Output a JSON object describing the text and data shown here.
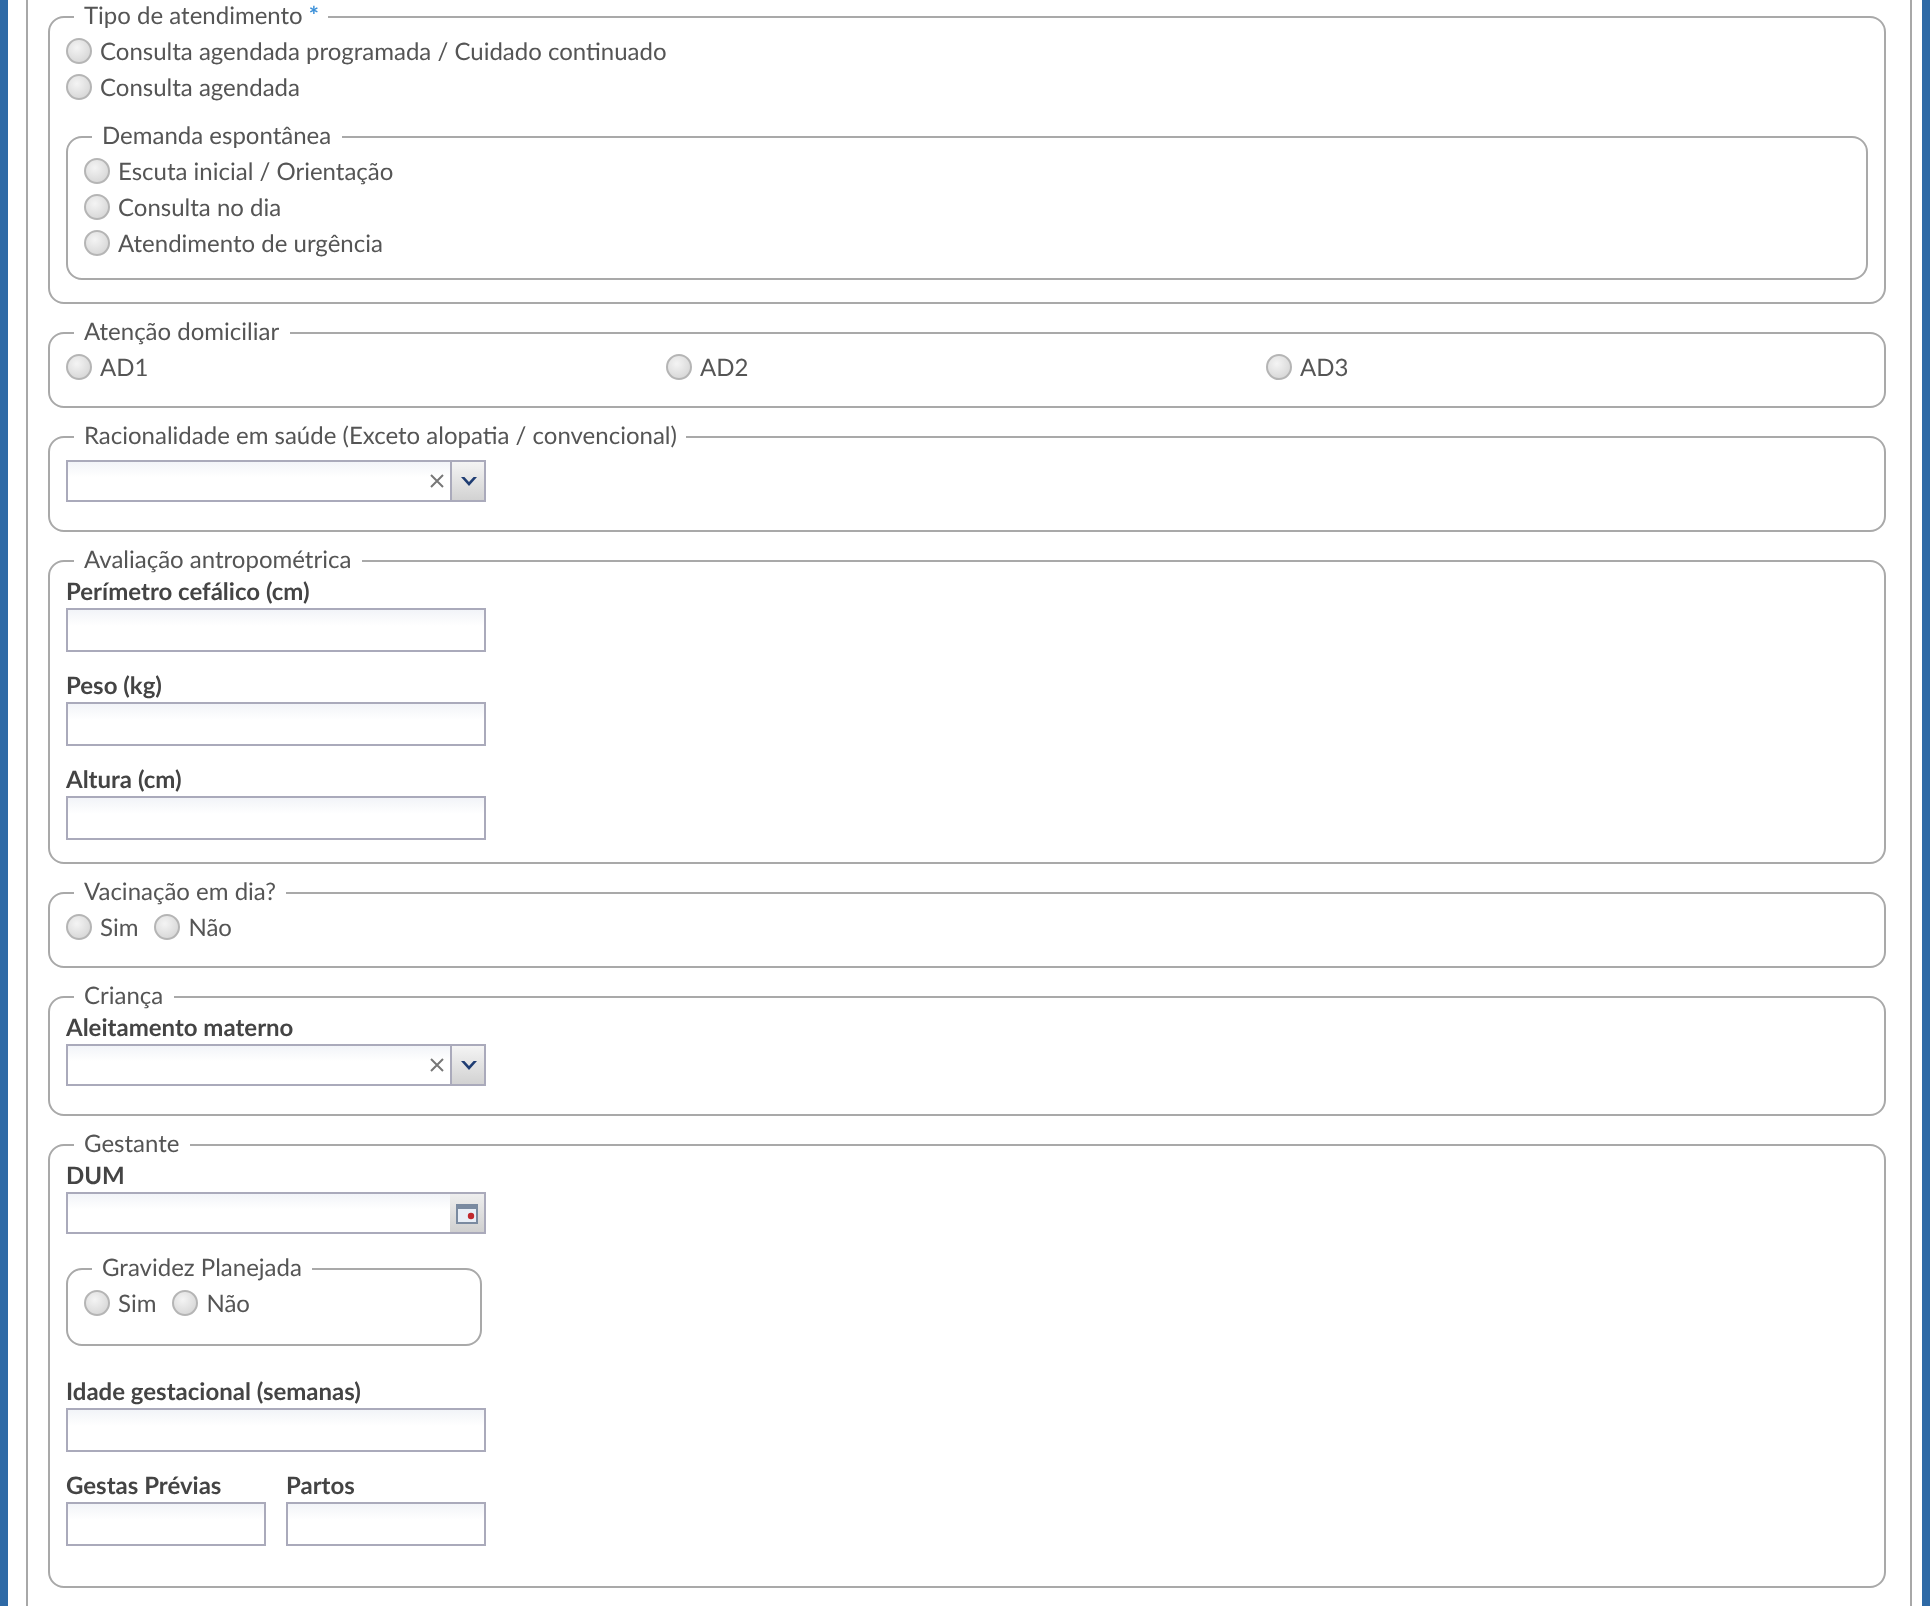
{
  "sections": [
    {
      "legend": "Tipo de atendimento",
      "required_mark": "*",
      "items": [
        {
          "kind": "radio_stack",
          "options": [
            {
              "label": "Consulta agendada programada / Cuidado continuado",
              "selected": false
            },
            {
              "label": "Consulta agendada",
              "selected": false
            }
          ]
        },
        {
          "kind": "fieldset",
          "legend": "Demanda espontânea",
          "items": [
            {
              "kind": "radio_stack",
              "options": [
                {
                  "label": "Escuta inicial / Orientação",
                  "selected": false
                },
                {
                  "label": "Consulta no dia",
                  "selected": false
                },
                {
                  "label": "Atendimento de urgência",
                  "selected": false
                }
              ]
            }
          ]
        }
      ]
    },
    {
      "legend": "Atenção domiciliar",
      "items": [
        {
          "kind": "radio_columns",
          "options": [
            {
              "label": "AD1",
              "selected": false
            },
            {
              "label": "AD2",
              "selected": false
            },
            {
              "label": "AD3",
              "selected": false
            }
          ]
        }
      ]
    },
    {
      "legend": "Racionalidade em saúde (Exceto alopatia / convencional)",
      "items": [
        {
          "kind": "select"
        }
      ]
    },
    {
      "legend": "Avaliação antropométrica",
      "items": [
        {
          "kind": "input",
          "label": "Perímetro cefálico (cm)"
        },
        {
          "kind": "input",
          "label": "Peso (kg)"
        },
        {
          "kind": "input",
          "label": "Altura (cm)"
        }
      ]
    },
    {
      "legend": "Vacinação em dia?",
      "items": [
        {
          "kind": "radio_row",
          "options": [
            {
              "label": "Sim",
              "selected": false
            },
            {
              "label": "Não",
              "selected": false
            }
          ]
        }
      ]
    },
    {
      "legend": "Criança",
      "items": [
        {
          "kind": "select",
          "label": "Aleitamento materno"
        }
      ]
    },
    {
      "legend": "Gestante",
      "items": [
        {
          "kind": "date",
          "label": "DUM"
        },
        {
          "kind": "fieldset",
          "legend": "Gravidez Planejada",
          "items": [
            {
              "kind": "radio_row",
              "options": [
                {
                  "label": "Sim",
                  "selected": false
                },
                {
                  "label": "Não",
                  "selected": false
                }
              ]
            }
          ]
        },
        {
          "kind": "input",
          "label": "Idade gestacional (semanas)"
        },
        {
          "kind": "inputs_row",
          "fields": [
            {
              "label": "Gestas Prévias"
            },
            {
              "label": "Partos"
            }
          ]
        }
      ]
    }
  ]
}
